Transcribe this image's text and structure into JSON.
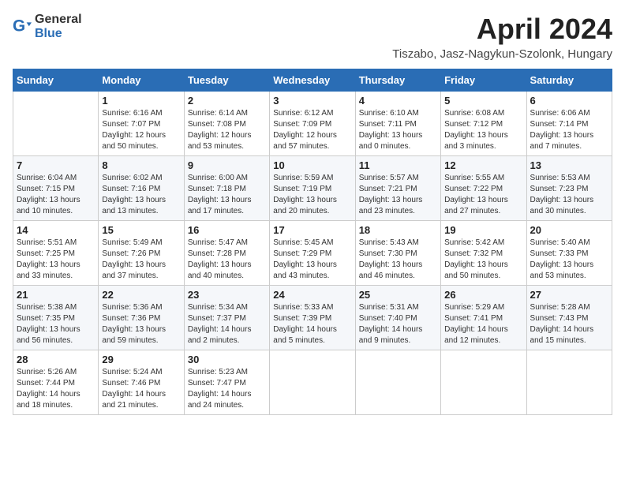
{
  "header": {
    "logo_general": "General",
    "logo_blue": "Blue",
    "title": "April 2024",
    "location": "Tiszabo, Jasz-Nagykun-Szolonk, Hungary"
  },
  "days_of_week": [
    "Sunday",
    "Monday",
    "Tuesday",
    "Wednesday",
    "Thursday",
    "Friday",
    "Saturday"
  ],
  "weeks": [
    [
      {
        "day": "",
        "info": ""
      },
      {
        "day": "1",
        "info": "Sunrise: 6:16 AM\nSunset: 7:07 PM\nDaylight: 12 hours\nand 50 minutes."
      },
      {
        "day": "2",
        "info": "Sunrise: 6:14 AM\nSunset: 7:08 PM\nDaylight: 12 hours\nand 53 minutes."
      },
      {
        "day": "3",
        "info": "Sunrise: 6:12 AM\nSunset: 7:09 PM\nDaylight: 12 hours\nand 57 minutes."
      },
      {
        "day": "4",
        "info": "Sunrise: 6:10 AM\nSunset: 7:11 PM\nDaylight: 13 hours\nand 0 minutes."
      },
      {
        "day": "5",
        "info": "Sunrise: 6:08 AM\nSunset: 7:12 PM\nDaylight: 13 hours\nand 3 minutes."
      },
      {
        "day": "6",
        "info": "Sunrise: 6:06 AM\nSunset: 7:14 PM\nDaylight: 13 hours\nand 7 minutes."
      }
    ],
    [
      {
        "day": "7",
        "info": "Sunrise: 6:04 AM\nSunset: 7:15 PM\nDaylight: 13 hours\nand 10 minutes."
      },
      {
        "day": "8",
        "info": "Sunrise: 6:02 AM\nSunset: 7:16 PM\nDaylight: 13 hours\nand 13 minutes."
      },
      {
        "day": "9",
        "info": "Sunrise: 6:00 AM\nSunset: 7:18 PM\nDaylight: 13 hours\nand 17 minutes."
      },
      {
        "day": "10",
        "info": "Sunrise: 5:59 AM\nSunset: 7:19 PM\nDaylight: 13 hours\nand 20 minutes."
      },
      {
        "day": "11",
        "info": "Sunrise: 5:57 AM\nSunset: 7:21 PM\nDaylight: 13 hours\nand 23 minutes."
      },
      {
        "day": "12",
        "info": "Sunrise: 5:55 AM\nSunset: 7:22 PM\nDaylight: 13 hours\nand 27 minutes."
      },
      {
        "day": "13",
        "info": "Sunrise: 5:53 AM\nSunset: 7:23 PM\nDaylight: 13 hours\nand 30 minutes."
      }
    ],
    [
      {
        "day": "14",
        "info": "Sunrise: 5:51 AM\nSunset: 7:25 PM\nDaylight: 13 hours\nand 33 minutes."
      },
      {
        "day": "15",
        "info": "Sunrise: 5:49 AM\nSunset: 7:26 PM\nDaylight: 13 hours\nand 37 minutes."
      },
      {
        "day": "16",
        "info": "Sunrise: 5:47 AM\nSunset: 7:28 PM\nDaylight: 13 hours\nand 40 minutes."
      },
      {
        "day": "17",
        "info": "Sunrise: 5:45 AM\nSunset: 7:29 PM\nDaylight: 13 hours\nand 43 minutes."
      },
      {
        "day": "18",
        "info": "Sunrise: 5:43 AM\nSunset: 7:30 PM\nDaylight: 13 hours\nand 46 minutes."
      },
      {
        "day": "19",
        "info": "Sunrise: 5:42 AM\nSunset: 7:32 PM\nDaylight: 13 hours\nand 50 minutes."
      },
      {
        "day": "20",
        "info": "Sunrise: 5:40 AM\nSunset: 7:33 PM\nDaylight: 13 hours\nand 53 minutes."
      }
    ],
    [
      {
        "day": "21",
        "info": "Sunrise: 5:38 AM\nSunset: 7:35 PM\nDaylight: 13 hours\nand 56 minutes."
      },
      {
        "day": "22",
        "info": "Sunrise: 5:36 AM\nSunset: 7:36 PM\nDaylight: 13 hours\nand 59 minutes."
      },
      {
        "day": "23",
        "info": "Sunrise: 5:34 AM\nSunset: 7:37 PM\nDaylight: 14 hours\nand 2 minutes."
      },
      {
        "day": "24",
        "info": "Sunrise: 5:33 AM\nSunset: 7:39 PM\nDaylight: 14 hours\nand 5 minutes."
      },
      {
        "day": "25",
        "info": "Sunrise: 5:31 AM\nSunset: 7:40 PM\nDaylight: 14 hours\nand 9 minutes."
      },
      {
        "day": "26",
        "info": "Sunrise: 5:29 AM\nSunset: 7:41 PM\nDaylight: 14 hours\nand 12 minutes."
      },
      {
        "day": "27",
        "info": "Sunrise: 5:28 AM\nSunset: 7:43 PM\nDaylight: 14 hours\nand 15 minutes."
      }
    ],
    [
      {
        "day": "28",
        "info": "Sunrise: 5:26 AM\nSunset: 7:44 PM\nDaylight: 14 hours\nand 18 minutes."
      },
      {
        "day": "29",
        "info": "Sunrise: 5:24 AM\nSunset: 7:46 PM\nDaylight: 14 hours\nand 21 minutes."
      },
      {
        "day": "30",
        "info": "Sunrise: 5:23 AM\nSunset: 7:47 PM\nDaylight: 14 hours\nand 24 minutes."
      },
      {
        "day": "",
        "info": ""
      },
      {
        "day": "",
        "info": ""
      },
      {
        "day": "",
        "info": ""
      },
      {
        "day": "",
        "info": ""
      }
    ]
  ]
}
